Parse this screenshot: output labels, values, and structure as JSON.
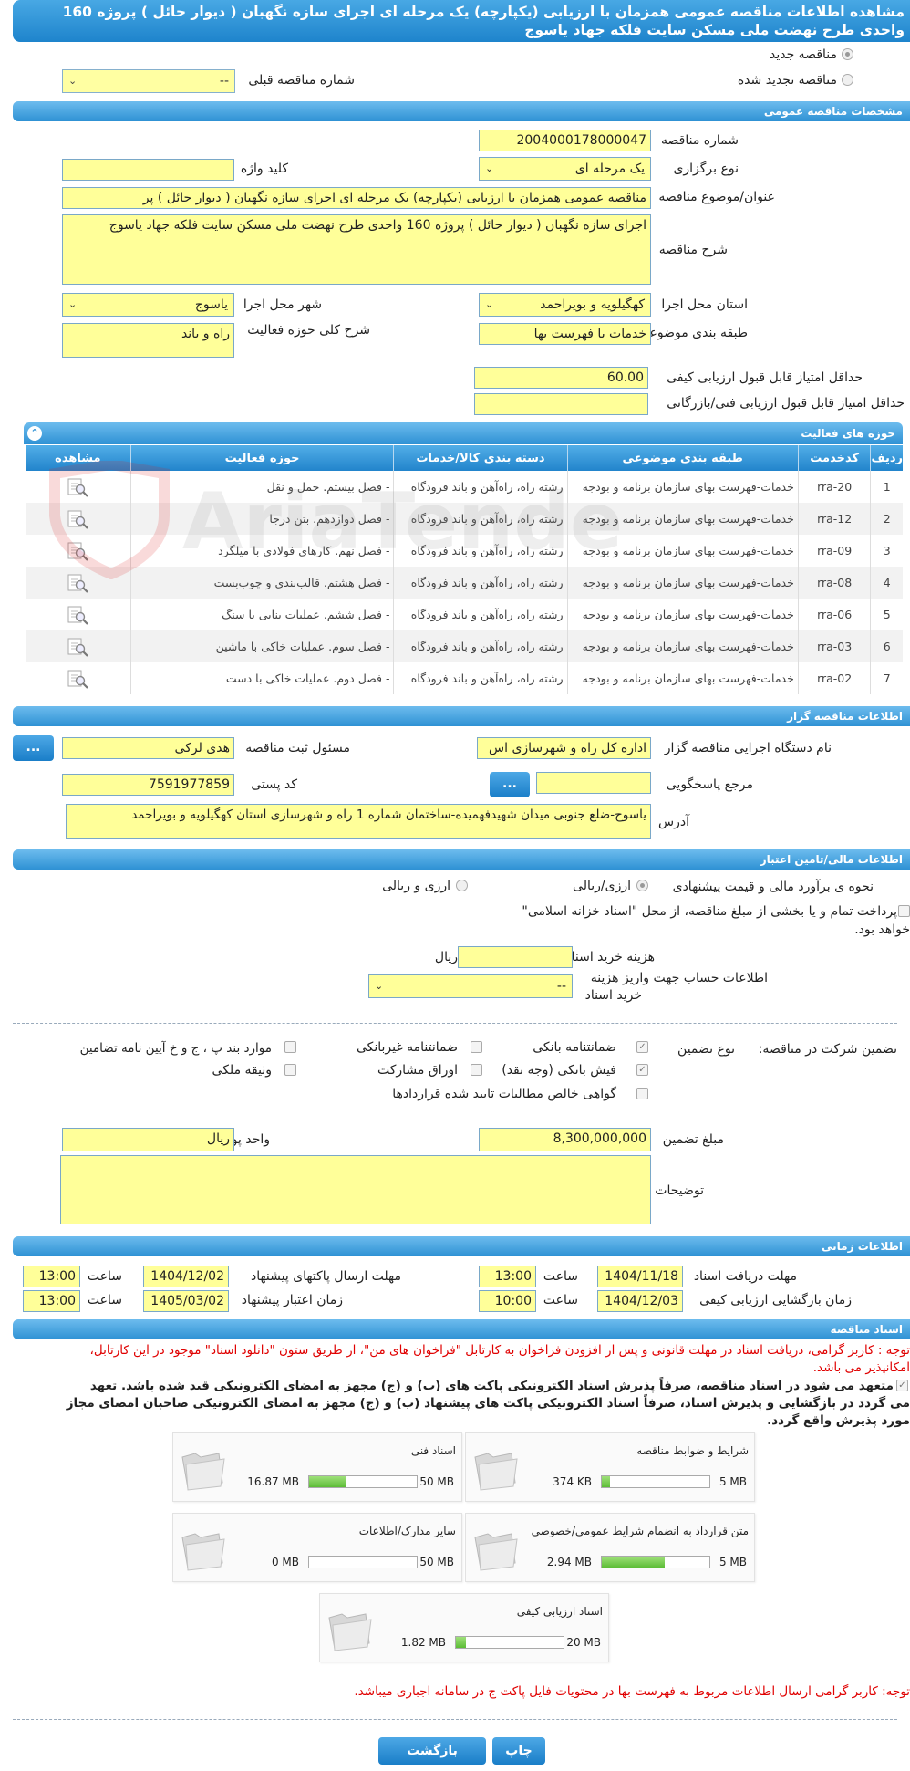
{
  "header": {
    "title": "مشاهده اطلاعات مناقصه عمومی همزمان با ارزیابی (یکپارچه) یک مرحله ای اجرای سازه نگهبان ( دیوار حائل ) پروژه 160 واحدی طرح نهضت ملی مسکن سایت فلکه جهاد یاسوج"
  },
  "tender_type": {
    "new_label": "مناقصه جدید",
    "renewed_label": "مناقصه تجدید شده",
    "prev_number_label": "شماره مناقصه قبلی",
    "prev_number_value": "--"
  },
  "general": {
    "section_title": "مشخصات مناقصه عمومی",
    "number_label": "شماره مناقصه",
    "number_value": "2004000178000047",
    "holding_type_label": "نوع برگزاری",
    "holding_type_value": "یک مرحله ای",
    "keyword_label": "کلید واژه",
    "keyword_value": "",
    "subject_label": "عنوان/موضوع مناقصه",
    "subject_value": "مناقصه عمومی همزمان با ارزیابی (یکپارچه) یک مرحله ای اجرای سازه نگهبان ( دیوار حائل ) پر",
    "desc_label": "شرح مناقصه",
    "desc_value": "اجرای سازه نگهبان ( دیوار حائل ) پروژه 160 واحدی طرح نهضت ملی مسکن سایت فلکه جهاد یاسوج",
    "province_label": "استان محل اجرا",
    "province_value": "کهگیلویه و بویراحمد",
    "city_label": "شهر محل اجرا",
    "city_value": "یاسوج",
    "category_label": "طبقه بندی موضوعی",
    "category_value": "خدمات با فهرست بها",
    "activity_desc_label": "شرح کلی حوزه فعالیت",
    "activity_desc_value": "راه و باند",
    "min_quality_label": "حداقل امتیاز قابل قبول ارزیابی کیفی",
    "min_quality_value": "60.00",
    "min_tech_label": "حداقل امتیاز قابل قبول ارزیابی فنی/بازرگانی",
    "min_tech_value": ""
  },
  "activities": {
    "section_title": "حوزه های فعالیت",
    "columns": [
      "ردیف",
      "کدخدمت",
      "طبقه بندی موضوعی",
      "دسته بندی کالا/خدمات",
      "حوزه فعالیت",
      "مشاهده"
    ],
    "rows": [
      {
        "n": "1",
        "code": "rra-20",
        "cat": "خدمات-فهرست بهای سازمان برنامه و بودجه",
        "group": "رشته راه، راه‌آهن و باند فرودگاه",
        "field": "- فصل بیستم. حمل و نقل"
      },
      {
        "n": "2",
        "code": "rra-12",
        "cat": "خدمات-فهرست بهای سازمان برنامه و بودجه",
        "group": "رشته راه، راه‌آهن و باند فرودگاه",
        "field": "- فصل دوازدهم. بتن درجا"
      },
      {
        "n": "3",
        "code": "rra-09",
        "cat": "خدمات-فهرست بهای سازمان برنامه و بودجه",
        "group": "رشته راه، راه‌آهن و باند فرودگاه",
        "field": "- فصل نهم. کارهای فولادی با میلگرد"
      },
      {
        "n": "4",
        "code": "rra-08",
        "cat": "خدمات-فهرست بهای سازمان برنامه و بودجه",
        "group": "رشته راه، راه‌آهن و باند فرودگاه",
        "field": "- فصل هشتم. قالب‌بندی و چوب‌بست"
      },
      {
        "n": "5",
        "code": "rra-06",
        "cat": "خدمات-فهرست بهای سازمان برنامه و بودجه",
        "group": "رشته راه، راه‌آهن و باند فرودگاه",
        "field": "- فصل ششم. عملیات بنایی با سنگ"
      },
      {
        "n": "6",
        "code": "rra-03",
        "cat": "خدمات-فهرست بهای سازمان برنامه و بودجه",
        "group": "رشته راه، راه‌آهن و باند فرودگاه",
        "field": "- فصل سوم. عملیات خاکی با ماشین"
      },
      {
        "n": "7",
        "code": "rra-02",
        "cat": "خدمات-فهرست بهای سازمان برنامه و بودجه",
        "group": "رشته راه، راه‌آهن و باند فرودگاه",
        "field": "- فصل دوم. عملیات خاکی با دست"
      }
    ]
  },
  "organizer": {
    "section_title": "اطلاعات مناقصه گزار",
    "org_label": "نام دستگاه اجرایی مناقصه گزار",
    "org_value": "اداره کل راه و شهرسازی اس",
    "registrar_label": "مسئول ثبت مناقصه",
    "registrar_value": "هدی لرکی",
    "reference_label": "مرجع پاسخگویی",
    "reference_value": "",
    "postal_label": "کد پستی",
    "postal_value": "7591977859",
    "address_label": "آدرس",
    "address_value": "یاسوج-ضلع جنوبی میدان شهیدفهمیده-ساختمان شماره 1 راه و شهرسازی استان کهگیلویه و بویراحمد",
    "more_button": "..."
  },
  "financial": {
    "section_title": "اطلاعات مالی/تامین اعتبار",
    "estimate_label": "نحوه ی برآورد مالی و قیمت پیشنهادی",
    "opt_fx": "ارزی/ریالی",
    "opt_fx_rial": "ارزی و ریالی",
    "treasury_text_1": "پرداخت تمام و یا بخشی از مبلغ مناقصه، از محل \"اسناد خزانه اسلامی\"",
    "treasury_text_2": "خواهد بود.",
    "doc_fee_label": "هزینه خرید اسناد",
    "doc_fee_value": "ریال",
    "account_label_1": "اطلاعات حساب جهت واریز هزینه",
    "account_label_2": "خرید اسناد",
    "account_value": "--"
  },
  "guarantee": {
    "participation_label": "تضمین شرکت در مناقصه:",
    "type_label": "نوع تضمین",
    "bank_guarantee": "ضمانتنامه بانکی",
    "nonbank_guarantee": "ضمانتنامه غیربانکی",
    "clauses": "موارد بند پ ، ج و خ آیین نامه تضامین",
    "cash_check": "فیش بانکی (وجه نقد)",
    "bonds": "اوراق مشارکت",
    "property": "وثیقه ملکی",
    "net_claims": "گواهی خالص مطالبات تایید شده قراردادها",
    "amount_label": "مبلغ تضمین",
    "amount_value": "8,300,000,000",
    "currency_label": "واحد پول",
    "currency_value": "ریال",
    "notes_label": "توضیحات",
    "notes_value": ""
  },
  "timing": {
    "section_title": "اطلاعات زمانی",
    "doc_deadline_label": "مهلت دریافت اسناد",
    "doc_deadline_date": "1404/11/18",
    "doc_deadline_time": "13:00",
    "submit_deadline_label": "مهلت ارسال پاکتهای پیشنهاد",
    "submit_deadline_date": "1404/12/02",
    "submit_deadline_time": "13:00",
    "opening_label": "زمان بازگشایی ارزیابی کیفی",
    "opening_date": "1404/12/03",
    "opening_time": "10:00",
    "validity_label": "زمان اعتبار پیشنهاد",
    "validity_date": "1405/03/02",
    "validity_time": "13:00",
    "time_label": "ساعت"
  },
  "documents": {
    "section_title": "اسناد مناقصه",
    "notice_1": "توجه : کاربر گرامی، دریافت اسناد در مهلت قانونی و پس از افزودن فراخوان به کارتابل \"فراخوان های من\"، از طریق ستون \"دانلود اسناد\" موجود در این کارتابل،",
    "notice_2": "امکانپذیر می باشد.",
    "commit_1": "متعهد می شود در اسناد مناقصه، صرفاً پذیرش اسناد الکترونیکی پاکت های (ب) و (ج) مجهز به امضای الکترونیکی قید شده باشد. تعهد",
    "commit_2": "می گردد در بازگشایی و پذیرش اسناد، صرفاً اسناد الکترونیکی پاکت های پیشنهاد (ب) و (ج) مجهز به امضای الکترونیکی صاحبان امضای مجاز",
    "commit_3": "مورد پذیرش واقع گردد.",
    "files": [
      {
        "title": "شرایط و ضوابط مناقصه",
        "size": "374 KB",
        "max": "5 MB",
        "fill": 0.073
      },
      {
        "title": "اسناد فنی",
        "size": "16.87 MB",
        "max": "50 MB",
        "fill": 0.337
      },
      {
        "title": "متن قرارداد به انضمام شرایط عمومی/خصوصی",
        "size": "2.94 MB",
        "max": "5 MB",
        "fill": 0.588
      },
      {
        "title": "سایر مدارک/اطلاعات",
        "size": "0 MB",
        "max": "50 MB",
        "fill": 0
      },
      {
        "title": "اسناد ارزیابی کیفی",
        "size": "1.82 MB",
        "max": "20 MB",
        "fill": 0.091
      }
    ],
    "price_list_notice": "توجه: کاربر گرامی ارسال اطلاعات مربوط به فهرست بها در محتویات فایل پاکت ج در سامانه اجباری میباشد."
  },
  "footer": {
    "print_button": "چاپ",
    "back_button": "بازگشت"
  },
  "watermark": "AriaTender.neT",
  "colors": {
    "header_blue": "#2a8fd4",
    "field_yellow": "#ffff99",
    "notice_red": "#e00000",
    "progress_green": "#6cc644"
  }
}
